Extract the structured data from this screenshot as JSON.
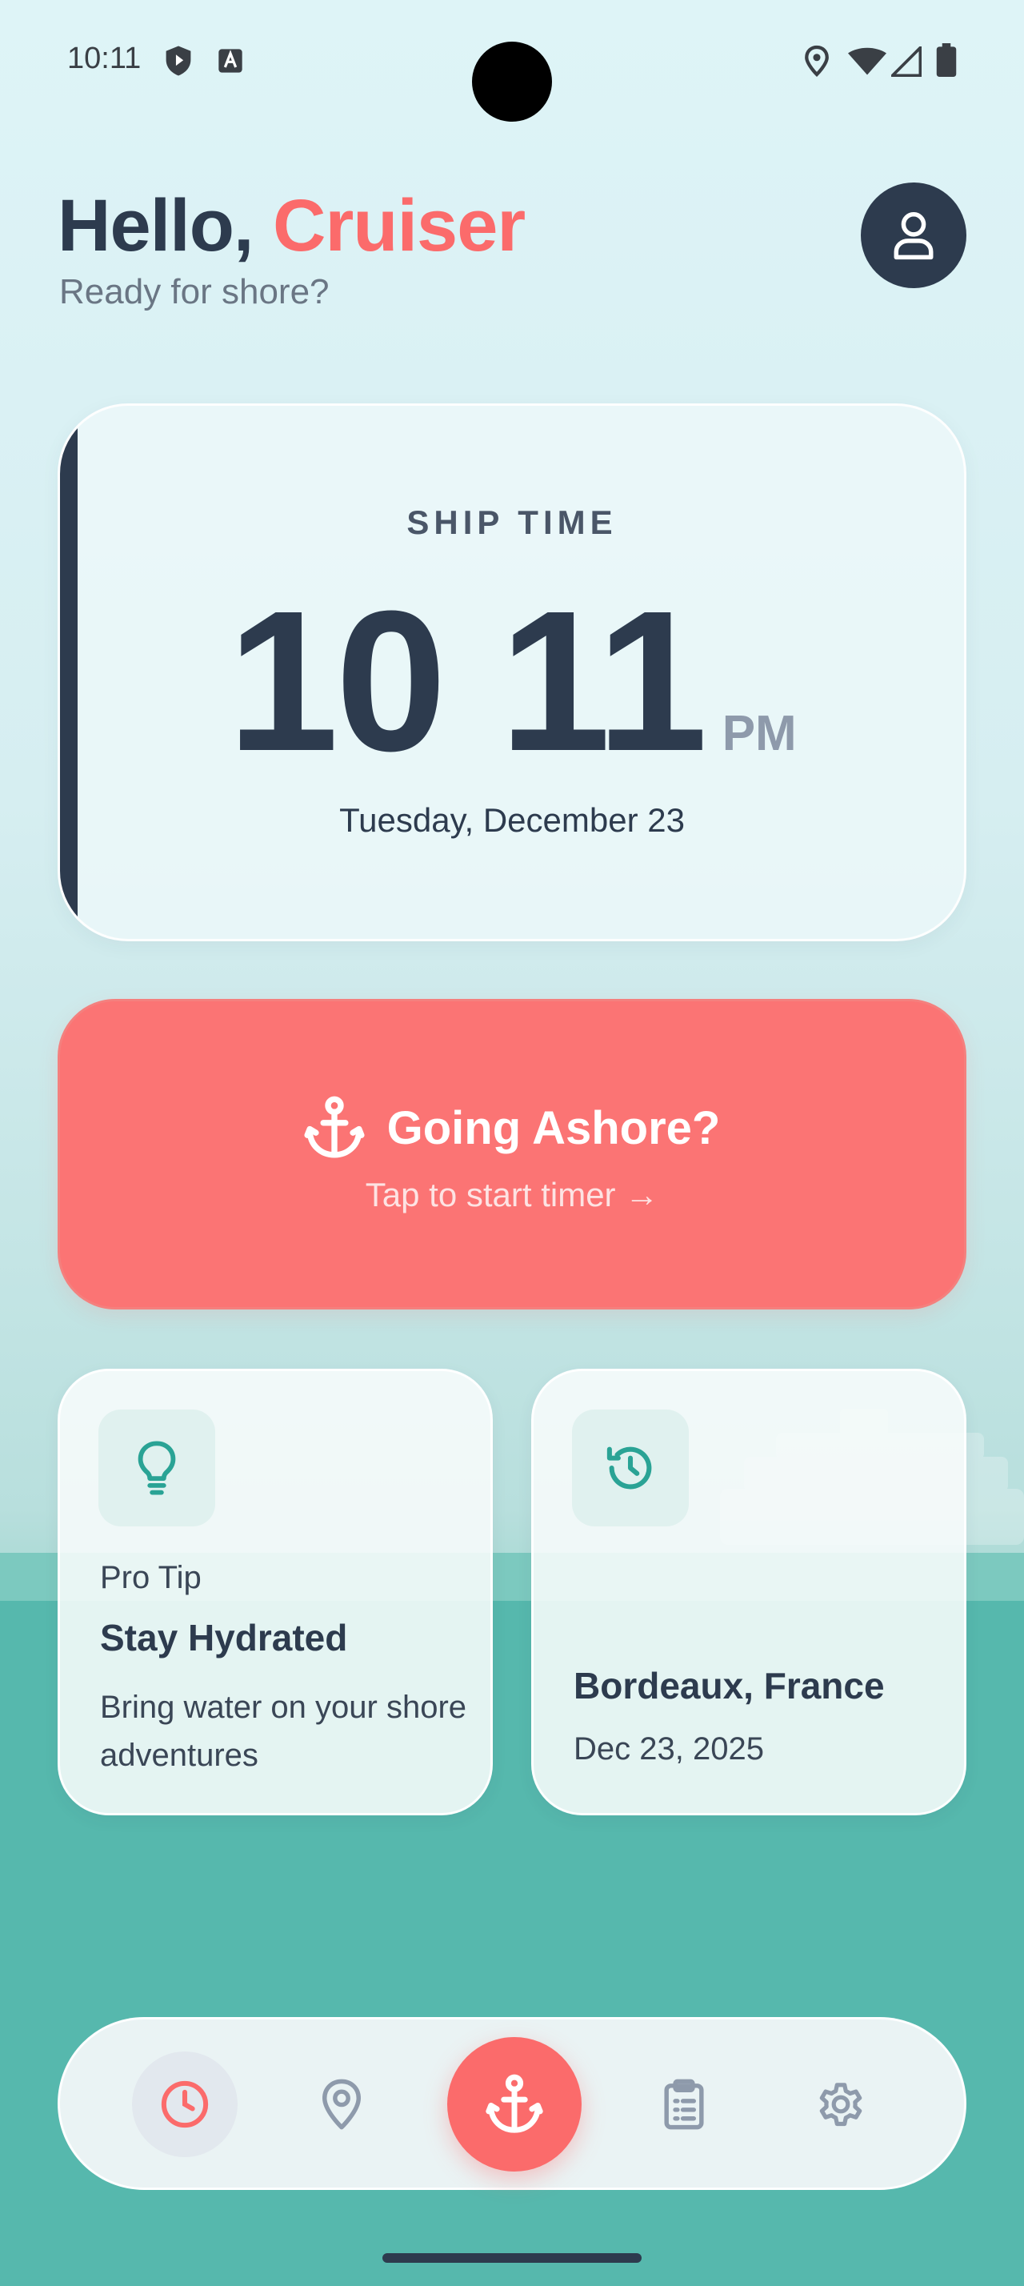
{
  "status_bar": {
    "time": "10:11",
    "left_icons": [
      "shield-play-icon",
      "a-box-icon"
    ],
    "right_icons": [
      "location-icon",
      "wifi-icon",
      "signal-icon",
      "battery-icon"
    ]
  },
  "header": {
    "greeting": "Hello,",
    "name": "Cruiser",
    "subtitle": "Ready for shore?",
    "avatar_icon": "user-icon"
  },
  "ship_time": {
    "label": "SHIP TIME",
    "hours": "10",
    "minutes": "11",
    "ampm": "PM",
    "date": "Tuesday, December 23"
  },
  "ashore_card": {
    "icon": "anchor-icon",
    "title": "Going Ashore?",
    "subtitle": "Tap to start timer →"
  },
  "tip_card": {
    "icon": "lightbulb-icon",
    "kicker": "Pro Tip",
    "title": "Stay Hydrated",
    "body": "Bring water on your shore adventures"
  },
  "history_card": {
    "icon": "history-icon",
    "place": "Bordeaux, France",
    "date": "Dec 23, 2025"
  },
  "bottom_nav": {
    "items": [
      {
        "icon": "clock-icon",
        "active": true
      },
      {
        "icon": "map-pin-icon",
        "active": false
      },
      {
        "icon": "anchor-icon",
        "active": false
      },
      {
        "icon": "clipboard-icon",
        "active": false
      },
      {
        "icon": "gear-icon",
        "active": false
      }
    ]
  },
  "colors": {
    "accent": "#fb6b6b",
    "navy": "#2d3b4e",
    "teal": "#2aa395",
    "sea": "#56b8ad"
  }
}
